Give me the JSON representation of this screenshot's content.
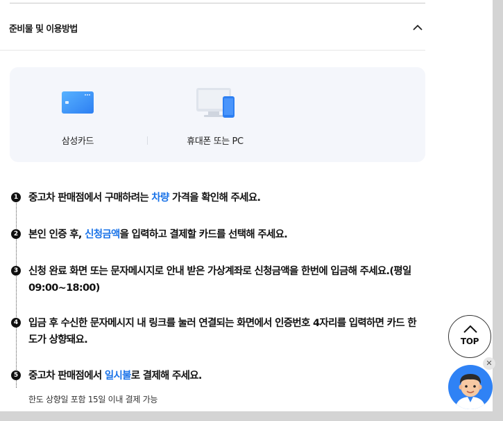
{
  "section": {
    "title": "준비물 및 이용방법"
  },
  "prep_items": [
    {
      "label": "삼성카드",
      "icon": "credit-card-icon"
    },
    {
      "label": "휴대폰 또는 PC",
      "icon": "device-icon"
    }
  ],
  "steps": [
    {
      "num": "1",
      "before": "중고차 판매점에서 구매하려는 ",
      "highlight": "차량",
      "after": " 가격을 확인해 주세요."
    },
    {
      "num": "2",
      "before": "본인 인증 후, ",
      "highlight": "신청금액",
      "after": "을 입력하고 결제할 카드를 선택해 주세요."
    },
    {
      "num": "3",
      "before": "신청 완료 화면 또는 문자메시지로 안내 받은 가상계좌로 신청금액을 한번에 입금해 주세요.(평일 09:00~18:00)",
      "highlight": "",
      "after": ""
    },
    {
      "num": "4",
      "before": "입금 후 수신한 문자메시지 내 링크를 눌러 연결되는 화면에서 인증번호 4자리를 입력하면 카드 한도가 상향돼요.",
      "highlight": "",
      "after": ""
    },
    {
      "num": "5",
      "before": "중고차 판매점에서 ",
      "highlight": "일시불",
      "after": "로 결제해 주세요."
    }
  ],
  "note": "한도 상향일 포함 15일 이내 결제 가능",
  "top_button": {
    "label": "TOP"
  },
  "colors": {
    "highlight": "#1a73e8",
    "card_bg": "#f4f6fb",
    "avatar_bg": "#2f82f5"
  }
}
